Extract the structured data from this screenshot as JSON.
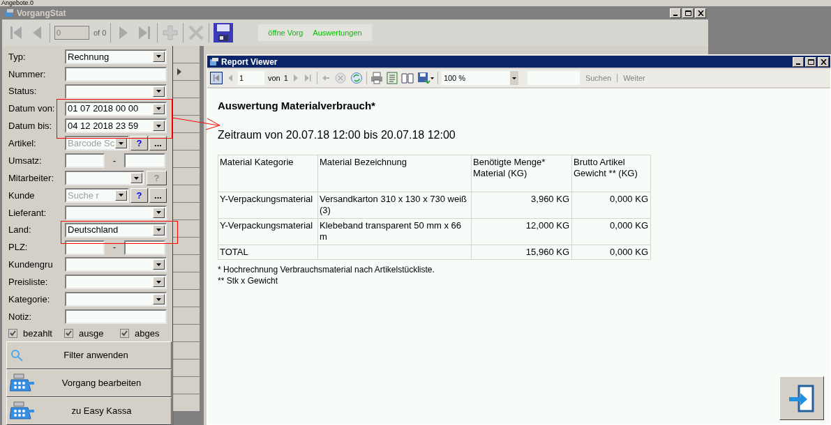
{
  "background_window": {
    "title": "Angebote.0"
  },
  "window": {
    "title": "VorgangStat"
  },
  "toolbar": {
    "record_field": "0",
    "record_count": "of 0",
    "links": [
      "öffne Vorg",
      "Auswertungen"
    ]
  },
  "filters": [
    {
      "kind": "combo",
      "label": "Typ:",
      "value": "Rechnung"
    },
    {
      "kind": "text",
      "label": "Nummer:"
    },
    {
      "kind": "combo",
      "label": "Status:"
    },
    {
      "kind": "combo",
      "label": "Datum von:",
      "value": "01 07 2018 00 00"
    },
    {
      "kind": "combo",
      "label": "Datum bis:",
      "value": "04 12 2018 23 59"
    },
    {
      "kind": "lookup",
      "label": "Artikel:",
      "placeholder": "Barcode Sc",
      "buttons": [
        {
          "label": "?",
          "disabled": false
        },
        {
          "label": "...",
          "disabled": false
        }
      ]
    },
    {
      "kind": "range",
      "label": "Umsatz:",
      "separator": "-"
    },
    {
      "kind": "combo_button",
      "label": "Mitarbeiter:",
      "buttons": [
        {
          "label": "?",
          "disabled": true
        }
      ]
    },
    {
      "kind": "lookup",
      "label": "Kunde",
      "placeholder": "Suche r",
      "buttons": [
        {
          "label": "?",
          "disabled": false
        },
        {
          "label": "...",
          "disabled": false
        }
      ]
    },
    {
      "kind": "combo",
      "label": "Lieferant:"
    },
    {
      "kind": "combo",
      "label": "Land:",
      "value": "Deutschland"
    },
    {
      "kind": "range",
      "label": "PLZ:",
      "separator": "-"
    },
    {
      "kind": "combo",
      "label": "Kundengru"
    },
    {
      "kind": "combo",
      "label": "Preisliste:"
    },
    {
      "kind": "combo",
      "label": "Kategorie:"
    },
    {
      "kind": "text",
      "label": "Notiz:"
    }
  ],
  "checkboxes": [
    {
      "label": "bezahlt",
      "checked": true,
      "disabled": true
    },
    {
      "label": "ausge",
      "checked": true,
      "disabled": true
    },
    {
      "label": "abges",
      "checked": true,
      "disabled": true
    }
  ],
  "actions": [
    {
      "label": "Filter anwenden",
      "kind": "search"
    },
    {
      "label": "Vorgang bearbeiten",
      "kind": "register"
    },
    {
      "label": "zu Easy Kassa",
      "kind": "register"
    }
  ],
  "record_grid": {
    "rows": [
      {
        "current": false
      },
      {
        "current": true
      },
      {
        "current": false
      },
      {
        "current": false
      },
      {
        "current": false
      },
      {
        "current": false
      },
      {
        "current": false
      },
      {
        "current": false
      },
      {
        "current": false
      },
      {
        "current": false
      },
      {
        "current": false
      },
      {
        "current": false
      },
      {
        "current": false
      },
      {
        "current": false
      },
      {
        "current": false
      },
      {
        "current": false
      },
      {
        "current": false
      },
      {
        "current": false
      },
      {
        "current": false
      },
      {
        "current": false
      },
      {
        "current": false
      }
    ]
  },
  "report_viewer": {
    "title": "Report Viewer",
    "page": "1",
    "of_label": "von",
    "page_count": "1",
    "zoom": "100 %",
    "search_buttons": [
      "Suchen",
      "Weiter"
    ]
  },
  "report": {
    "title": "Auswertung Materialverbrauch*",
    "subtitle": "Zeitraum von 20.07.18 12:00 bis 20.07.18 12:00",
    "columns": [
      "Material Kategorie",
      "Material Bezeichnung",
      "Benötigte Menge* Material (KG)",
      "Brutto Artikel Gewicht ** (KG)"
    ],
    "rows": [
      [
        "Y-Verpackungsmaterial",
        "Versandkarton 310 x 130 x 730 weiß (3)",
        "3,960 KG",
        "0,000 KG"
      ],
      [
        "Y-Verpackungsmaterial",
        "Klebeband transparent 50 mm x 66 m",
        "12,000 KG",
        "0,000 KG"
      ],
      [
        "TOTAL",
        "",
        "15,960 KG",
        "0,000 KG"
      ]
    ],
    "footnotes": [
      "* Hochrechnung Verbrauchsmaterial nach Artikelstückliste.",
      "** Stk x Gewicht"
    ]
  }
}
